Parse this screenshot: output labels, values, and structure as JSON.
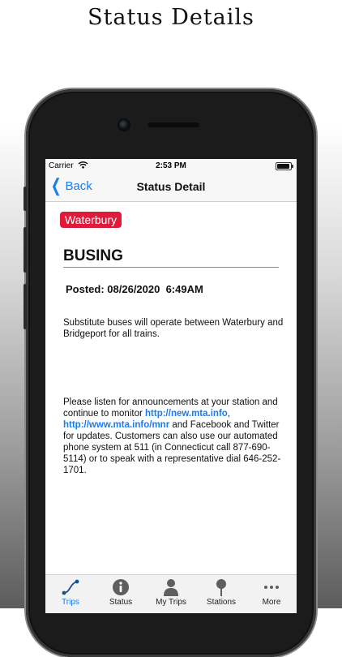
{
  "promo": {
    "title": "Status Details"
  },
  "status_bar": {
    "carrier": "Carrier",
    "time": "2:53 PM"
  },
  "nav": {
    "back_label": "Back",
    "title": "Status Detail"
  },
  "detail": {
    "line_badge": "Waterbury",
    "line_badge_color": "#e01a3b",
    "heading": "BUSING",
    "posted": "Posted: 08/26/2020  6:49AM",
    "paragraph1": "Substitute buses will operate between Waterbury and Bridgeport for all trains.",
    "paragraph2_a": "Please listen for announcements at your station and continue to monitor ",
    "link1": "http://new.mta.info",
    "paragraph2_b": ", ",
    "link2": "http://www.mta.info/mnr",
    "paragraph2_c": " and Facebook and Twitter for updates. Customers can also use our automated phone system at 511 (in Connecticut call 877-690-5114) or to speak with a representative dial 646-252-1701."
  },
  "tabs": [
    {
      "label": "Trips",
      "icon": "route-icon",
      "active": true
    },
    {
      "label": "Status",
      "icon": "info-icon",
      "active": false
    },
    {
      "label": "My Trips",
      "icon": "person-icon",
      "active": false
    },
    {
      "label": "Stations",
      "icon": "pin-icon",
      "active": false
    },
    {
      "label": "More",
      "icon": "more-icon",
      "active": false
    }
  ],
  "colors": {
    "accent": "#1a7bf2",
    "badge": "#e01a3b"
  }
}
